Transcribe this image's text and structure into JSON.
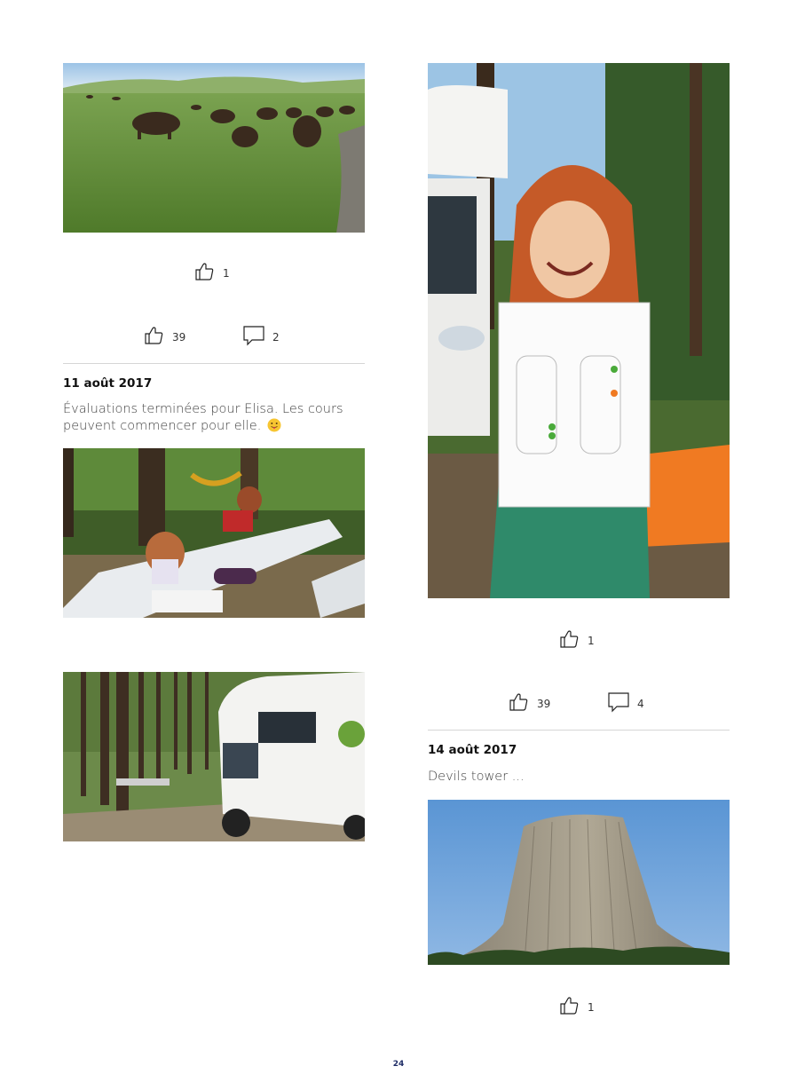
{
  "left_column": {
    "photo_bison": {
      "description_icon": "bison-herd-photo"
    },
    "photo_bison_likes": "1",
    "post_stats": {
      "likes": "39",
      "comments": "2"
    },
    "post": {
      "date": "11 août 2017",
      "text": "Évaluations terminées pour Elisa. Les cours peuvent commencer pour elle."
    },
    "photo_picnic": {
      "description_icon": "kids-studying-photo"
    },
    "photo_campervan": {
      "description_icon": "campervan-photo"
    }
  },
  "right_column": {
    "photo_girl": {
      "description_icon": "girl-with-evaluation-photo"
    },
    "photo_girl_likes": "1",
    "post_stats": {
      "likes": "39",
      "comments": "4"
    },
    "post": {
      "date": "14 août 2017",
      "text": "Devils tower ..."
    },
    "photo_tower": {
      "description_icon": "devils-tower-photo"
    },
    "photo_tower_likes": "1"
  },
  "footer": {
    "page_number": "24"
  },
  "colors": {
    "page_number": "#1e2c66",
    "divider": "#d6d6d6"
  }
}
